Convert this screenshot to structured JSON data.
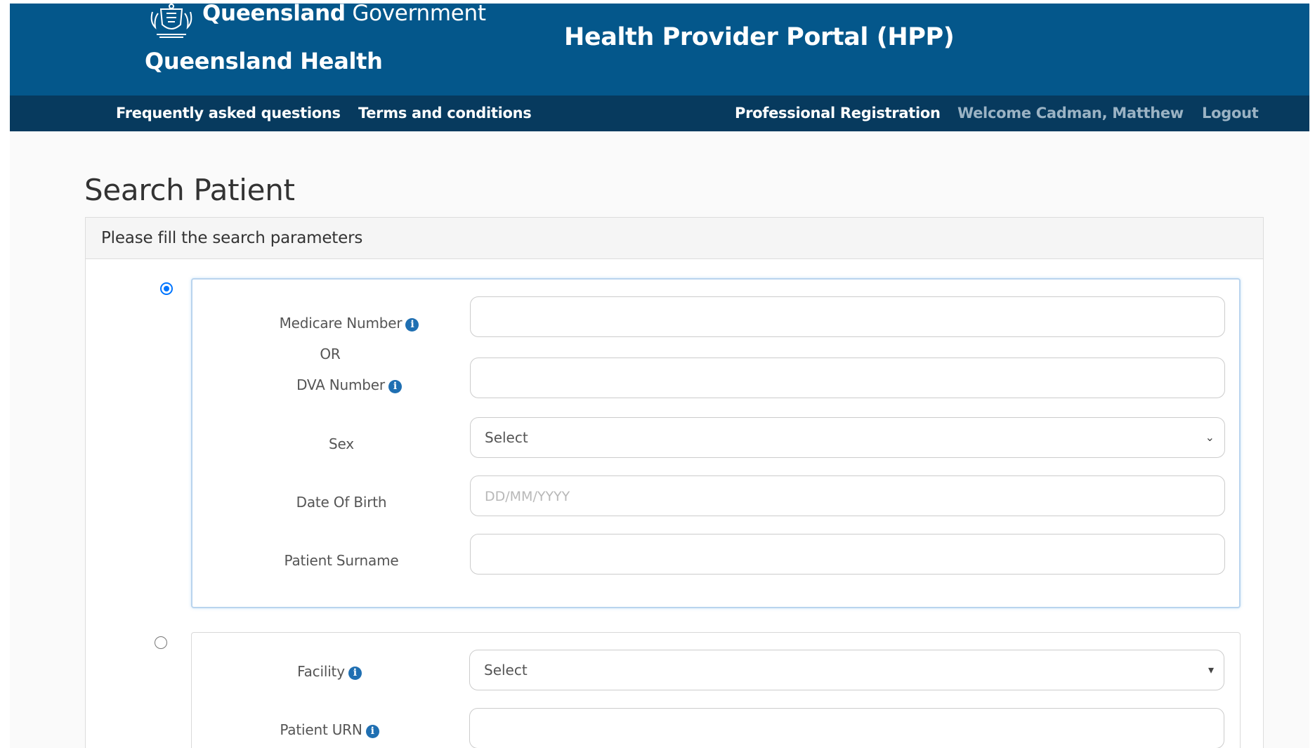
{
  "header": {
    "gov_bold": "Queensland",
    "gov_thin": "Government",
    "dept": "Queensland Health",
    "portal_title": "Health Provider Portal (HPP)"
  },
  "nav": {
    "faq": "Frequently asked questions",
    "terms": "Terms and conditions",
    "registration": "Professional Registration",
    "welcome": "Welcome Cadman, Matthew",
    "logout": "Logout"
  },
  "page": {
    "title": "Search Patient",
    "panel_heading": "Please fill the search parameters"
  },
  "group1": {
    "selected": true,
    "medicare_label": "Medicare Number",
    "or_label": "OR",
    "dva_label": "DVA Number",
    "sex_label": "Sex",
    "sex_value": "Select",
    "dob_label": "Date Of Birth",
    "dob_placeholder": "DD/MM/YYYY",
    "surname_label": "Patient Surname"
  },
  "group2": {
    "selected": false,
    "facility_label": "Facility",
    "facility_value": "Select",
    "urn_label": "Patient URN"
  },
  "icons": {
    "info": "i",
    "dropdown_a": "⌄",
    "dropdown_b": "▾"
  },
  "colors": {
    "header_bg": "#04578b",
    "nav_bg": "#073a5e",
    "radio_accent": "#0075ff",
    "info_icon": "#1f6fb2"
  }
}
